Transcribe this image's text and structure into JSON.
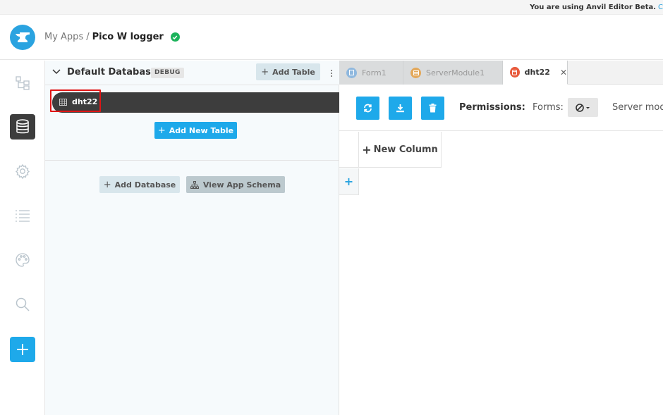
{
  "banner": {
    "text": "You are using Anvil Editor Beta.",
    "more": "C"
  },
  "header": {
    "crumb_root": "My Apps",
    "separator": "/",
    "app_name": "Pico W logger"
  },
  "rail": {
    "icons": [
      "app-tree-icon",
      "database-icon",
      "settings-gear-icon",
      "list-icon",
      "palette-icon",
      "search-icon",
      "plus-icon"
    ],
    "active": "database-icon"
  },
  "db_panel": {
    "title": "Default Database",
    "badge": "DEBUG",
    "add_table_label": "Add Table",
    "tables": [
      {
        "name": "dht22"
      }
    ],
    "add_new_table_label": "Add New Table",
    "add_database_label": "Add Database",
    "view_schema_label": "View App Schema"
  },
  "tabs": [
    {
      "label": "Form1",
      "icon_color": "#8fb8de",
      "active": false
    },
    {
      "label": "ServerModule1",
      "icon_color": "#e3a85a",
      "active": false
    },
    {
      "label": "dht22",
      "icon_color": "#e85a3c",
      "active": true
    }
  ],
  "toolbar": {
    "permissions_label": "Permissions:",
    "forms_label": "Forms:",
    "server_label": "Server mod"
  },
  "grid": {
    "new_column_label": "New Column"
  },
  "colors": {
    "accent": "#1ea9ea",
    "dark": "#3d3d3d",
    "highlight": "#e01515",
    "success": "#1cb35b"
  }
}
